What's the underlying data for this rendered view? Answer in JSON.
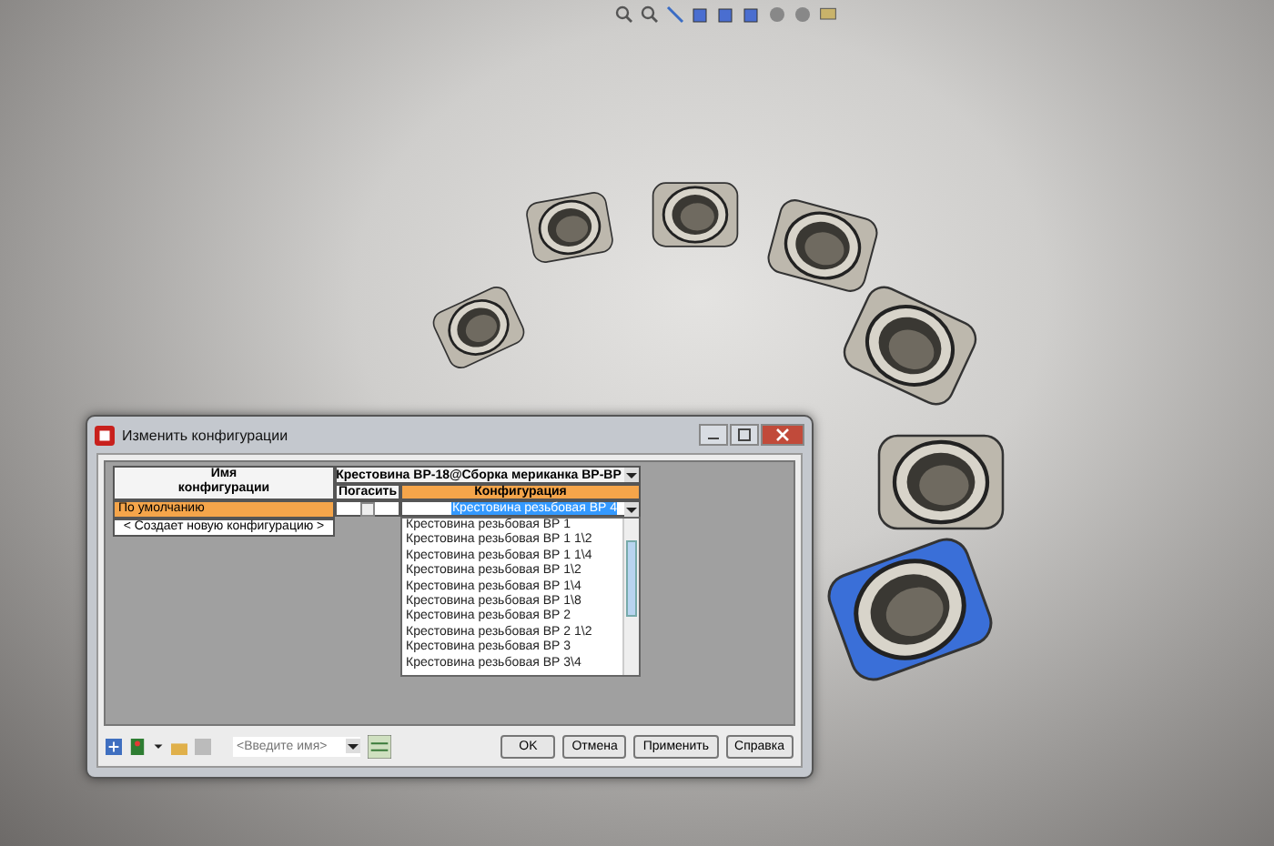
{
  "parts": [
    {
      "selected": false
    },
    {
      "selected": false
    },
    {
      "selected": false
    },
    {
      "selected": false
    },
    {
      "selected": false
    },
    {
      "selected": false
    },
    {
      "selected": true
    }
  ],
  "dialog": {
    "title": "Изменить конфигурации",
    "name_header": "Имя конфигурации",
    "assembly_header": "Крестовина ВР-18@Сборка мериканка ВР-ВР",
    "columns": [
      "Погасить",
      "Конфигурация"
    ],
    "rows": [
      {
        "name": "По умолчанию",
        "selected": true,
        "suppressed": false,
        "configuration": "Крестовина резьбовая ВР 4"
      }
    ],
    "new_row": "< Создает новую конфигурацию >",
    "dropdown": {
      "options": [
        {
          "label": "Крестовина резьбовая ВР 1"
        },
        {
          "label": "Крестовина резьбовая ВР 1 1\\2"
        },
        {
          "label": "Крестовина резьбовая ВР 1 1\\4"
        },
        {
          "label": "Крестовина резьбовая ВР 1\\2"
        },
        {
          "label": "Крестовина резьбовая ВР 1\\4"
        },
        {
          "label": "Крестовина резьбовая ВР 1\\8"
        },
        {
          "label": "Крестовина резьбовая ВР 2"
        },
        {
          "label": "Крестовина резьбовая ВР 2 1\\2"
        },
        {
          "label": "Крестовина резьбовая ВР 3"
        },
        {
          "label": "Крестовина резьбовая ВР 3\\4"
        }
      ]
    },
    "name_field": {
      "placeholder": "<Введите имя>"
    },
    "buttons": [
      "OK",
      "Отмена",
      "Применить",
      "Справка"
    ]
  }
}
